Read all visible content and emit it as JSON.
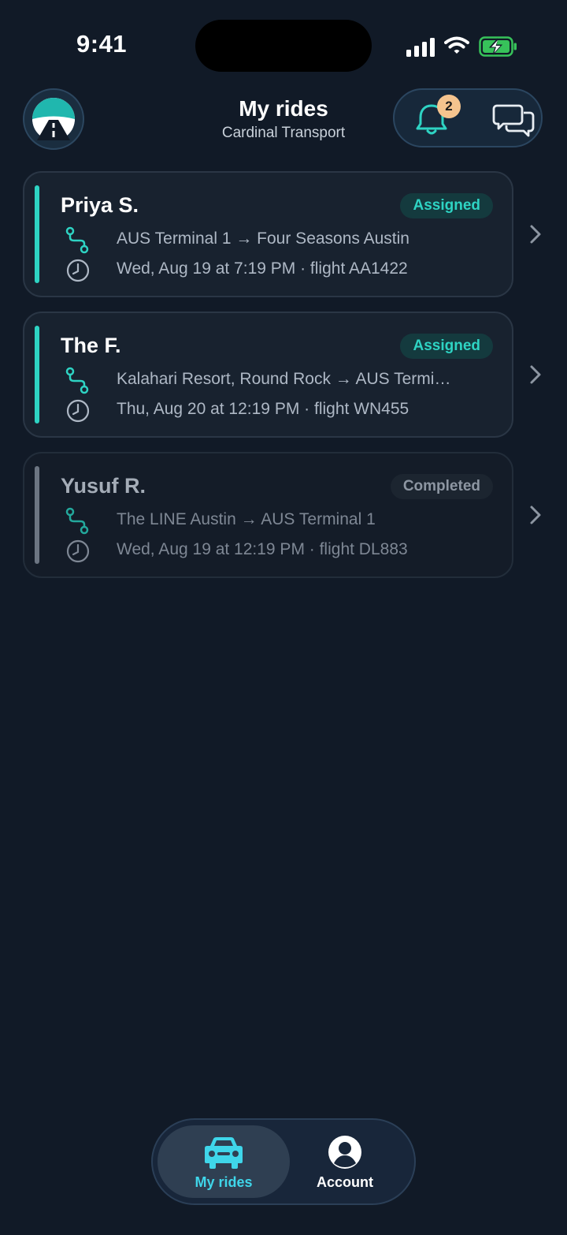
{
  "status_bar": {
    "time": "9:41"
  },
  "header": {
    "title": "My rides",
    "subtitle": "Cardinal Transport",
    "notifications_count": "2",
    "logo_icon": "road-logo-icon",
    "bell_icon": "bell-icon",
    "chat_icon": "chat-bubbles-icon"
  },
  "rides": [
    {
      "name": "Priya S.",
      "status": "Assigned",
      "route": "AUS Terminal 1 → Four Seasons Austin",
      "time": "Wed, Aug 19 at 7:19 PM · flight AA1422"
    },
    {
      "name": "The F.",
      "status": "Assigned",
      "route": "Kalahari Resort, Round Rock → AUS Termi…",
      "time": "Thu, Aug 20 at 12:19 PM · flight WN455"
    },
    {
      "name": "Yusuf R.",
      "status": "Completed",
      "route": "The LINE Austin → AUS Terminal 1",
      "time": "Wed, Aug 19 at 12:19 PM · flight DL883"
    }
  ],
  "bottom_nav": {
    "items": [
      {
        "label": "My rides",
        "icon": "car-icon",
        "active": true
      },
      {
        "label": "Account",
        "icon": "account-icon",
        "active": false
      }
    ]
  },
  "colors": {
    "background": "#111a27",
    "accent_teal": "#2ed3c3",
    "nav_active": "#3fd6ea",
    "badge_orange": "#f5c48e",
    "completed_gray": "#6c7582"
  }
}
